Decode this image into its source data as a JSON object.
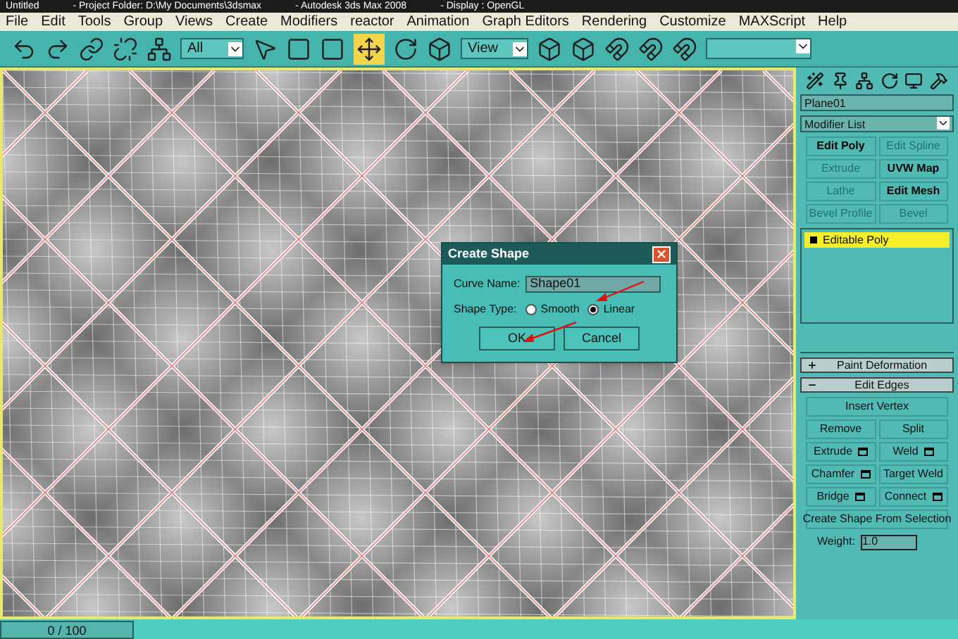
{
  "title_bar": {
    "texts": [
      "Untitled",
      "- Project Folder: D:\\My Documents\\3dsmax",
      "- Autodesk 3ds Max 2008",
      "- Display : OpenGL"
    ]
  },
  "menu": [
    "File",
    "Edit",
    "Tools",
    "Group",
    "Views",
    "Create",
    "Modifiers",
    "reactor",
    "Animation",
    "Graph Editors",
    "Rendering",
    "Customize",
    "MAXScript",
    "Help"
  ],
  "toolbar": {
    "selection_filter": "All",
    "reference_coordinate": "View"
  },
  "dialog": {
    "title": "Create Shape",
    "curve_name_label": "Curve Name:",
    "curve_name_value": "Shape01",
    "shape_type_label": "Shape Type:",
    "options": [
      {
        "label": "Smooth",
        "selected": false
      },
      {
        "label": "Linear",
        "selected": true
      }
    ],
    "buttons": [
      "OK",
      "Cancel"
    ]
  },
  "command_panel": {
    "object_name": "Plane01",
    "modifier_list": "Modifier List",
    "modifier_buttons": [
      {
        "label": "Edit Poly",
        "disabled": false
      },
      {
        "label": "Edit Spline",
        "disabled": true
      },
      {
        "label": "Extrude",
        "disabled": true
      },
      {
        "label": "UVW Map",
        "disabled": false
      },
      {
        "label": "Lathe",
        "disabled": true
      },
      {
        "label": "Edit Mesh",
        "disabled": false
      },
      {
        "label": "Bevel Profile",
        "disabled": true
      },
      {
        "label": "Bevel",
        "disabled": true
      }
    ],
    "stack": [
      {
        "label": "Editable Poly",
        "selected": true
      }
    ],
    "rollouts": [
      {
        "label": "Paint Deformation",
        "expanded": false
      },
      {
        "label": "Edit Edges",
        "expanded": true
      }
    ],
    "edge_buttons": [
      {
        "kind": "wide",
        "label": "Insert Vertex",
        "settings": false
      },
      {
        "kind": "half",
        "label": "Remove",
        "settings": false
      },
      {
        "kind": "half",
        "label": "Split",
        "settings": false
      },
      {
        "kind": "half",
        "label": "Extrude",
        "settings": true
      },
      {
        "kind": "half",
        "label": "Weld",
        "settings": true
      },
      {
        "kind": "half",
        "label": "Chamfer",
        "settings": true
      },
      {
        "kind": "half",
        "label": "Target Weld",
        "settings": false
      },
      {
        "kind": "half",
        "label": "Bridge",
        "settings": true
      },
      {
        "kind": "half",
        "label": "Connect",
        "settings": true
      },
      {
        "kind": "wide",
        "label": "Create Shape From Selection",
        "settings": false
      }
    ],
    "weight_label": "Weight:",
    "weight_value": "1.0"
  },
  "time_slider": "0 / 100"
}
